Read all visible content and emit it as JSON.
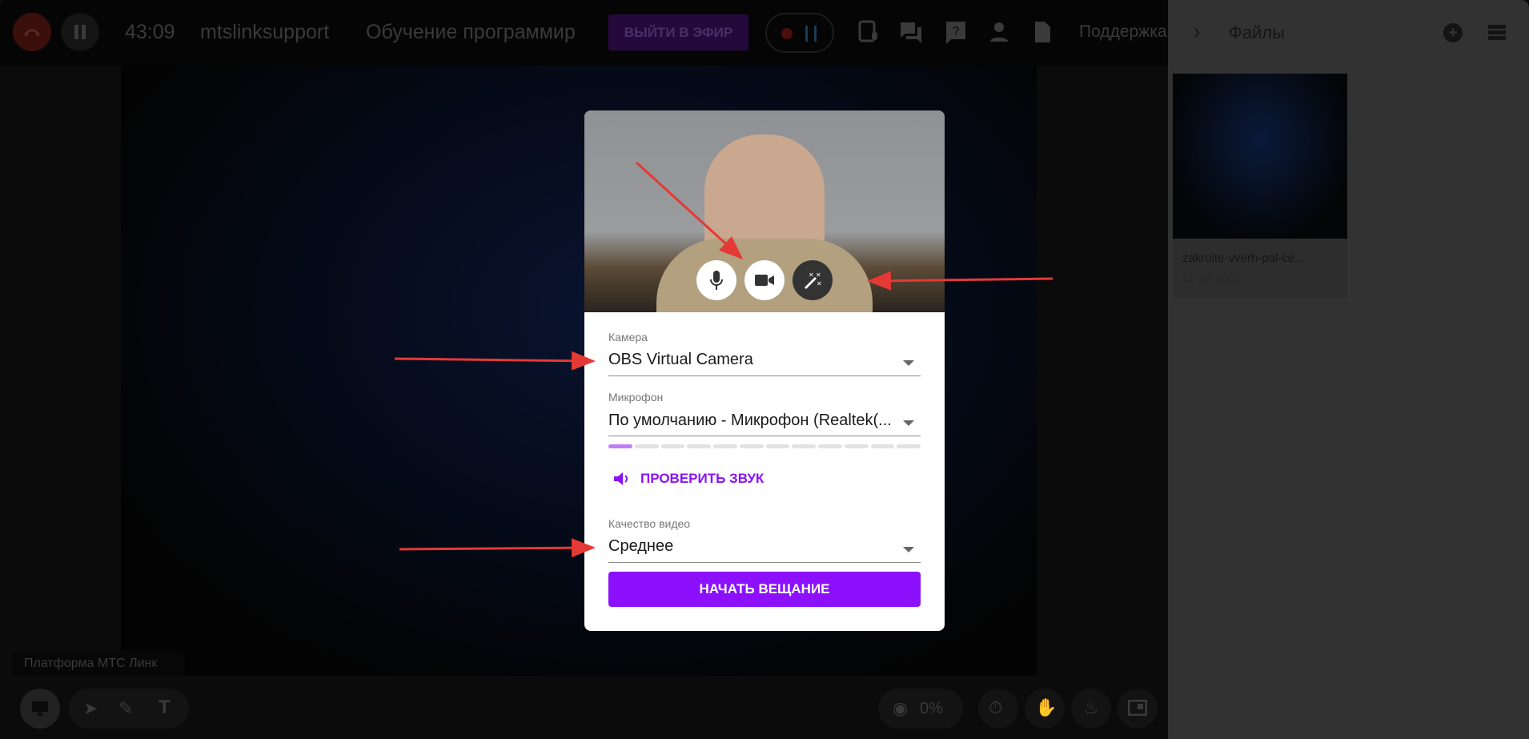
{
  "topbar": {
    "time": "43:09",
    "user": "mtslinksupport",
    "event_title": "Обучение программир",
    "onair_label": "ВЫЙТИ В ЭФИР",
    "support_label": "Поддержка"
  },
  "files_panel": {
    "title": "Файлы",
    "file": {
      "name": "zakroite-vverh-pal-ce...",
      "date": "01 окт. 2025"
    }
  },
  "stage": {
    "platform_label": "Платформа МТС Линк",
    "engagement": "0%"
  },
  "modal": {
    "camera_label": "Камера",
    "camera_value": "OBS Virtual Camera",
    "mic_label": "Микрофон",
    "mic_value": "По умолчанию - Микрофон (Realtek(...",
    "mic_level_segments": 12,
    "mic_level_active": 1,
    "check_sound": "ПРОВЕРИТЬ ЗВУК",
    "quality_label": "Качество видео",
    "quality_value": "Среднее",
    "start_button": "НАЧАТЬ ВЕЩАНИЕ"
  },
  "colors": {
    "accent": "#8c10fc",
    "annotation": "#e53935"
  }
}
